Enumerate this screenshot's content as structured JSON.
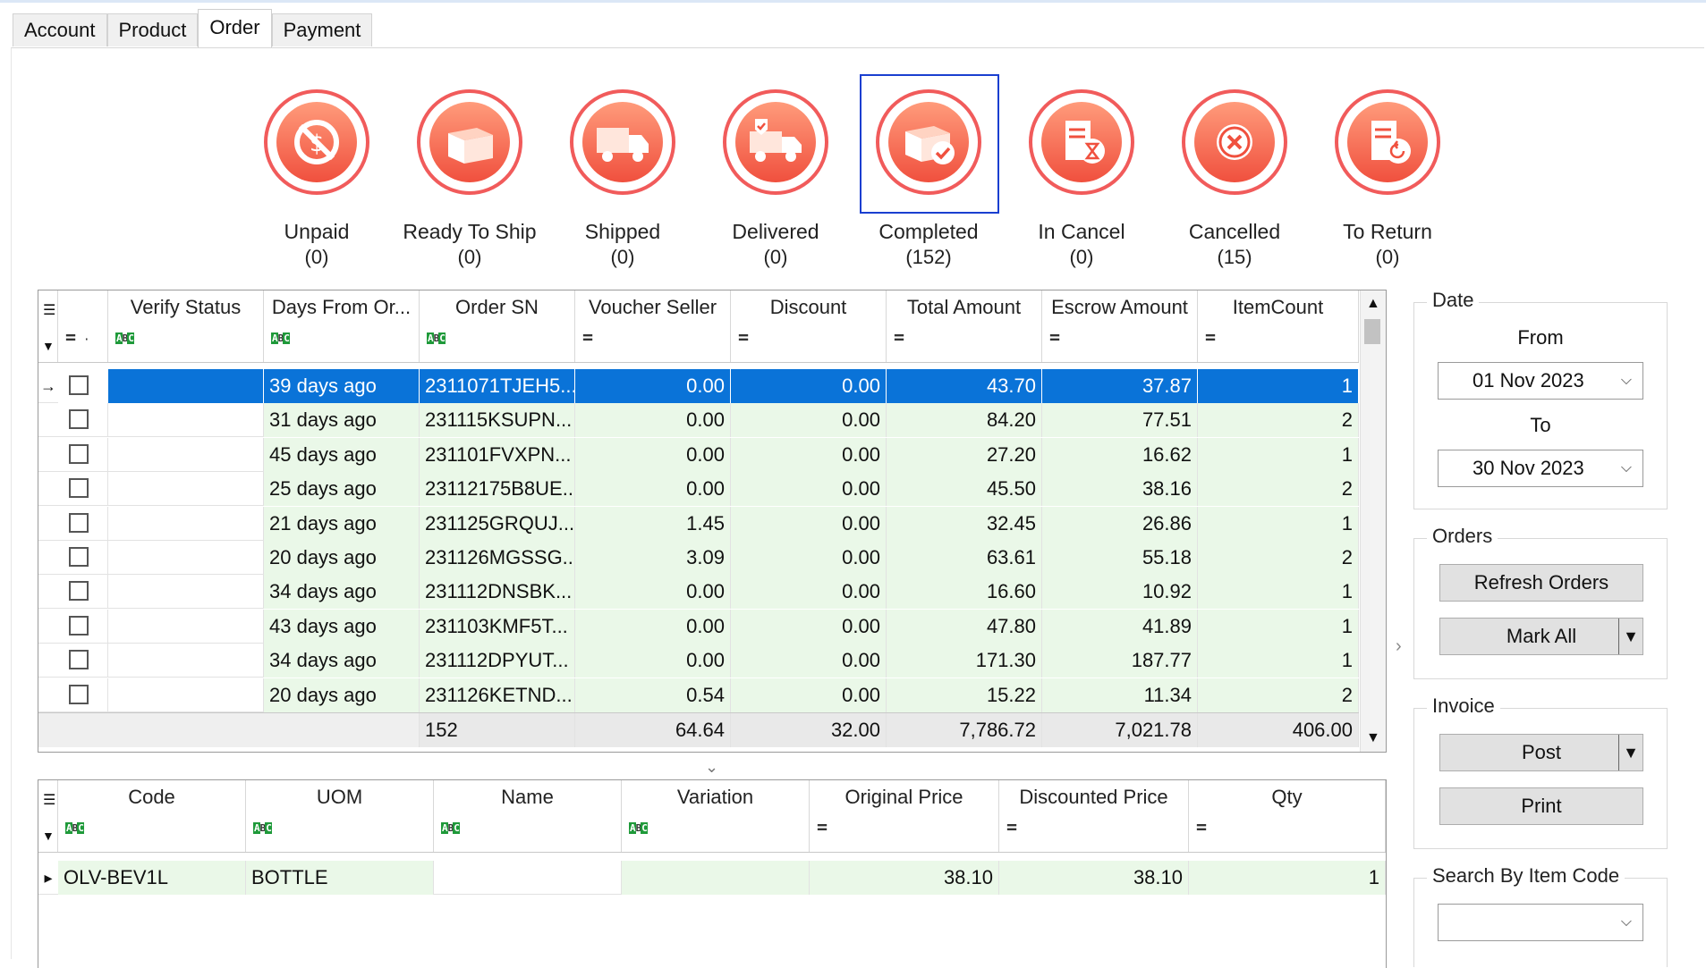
{
  "tabs": [
    "Account",
    "Product",
    "Order",
    "Payment"
  ],
  "active_tab": "Order",
  "statuses": [
    {
      "label": "Unpaid",
      "count": "(0)",
      "icon": "unpaid-icon"
    },
    {
      "label": "Ready To Ship",
      "count": "(0)",
      "icon": "box-icon"
    },
    {
      "label": "Shipped",
      "count": "(0)",
      "icon": "truck-icon"
    },
    {
      "label": "Delivered",
      "count": "(0)",
      "icon": "delivered-truck-icon"
    },
    {
      "label": "Completed",
      "count": "(152)",
      "icon": "completed-box-icon"
    },
    {
      "label": "In Cancel",
      "count": "(0)",
      "icon": "hourglass-document-icon"
    },
    {
      "label": "Cancelled",
      "count": "(15)",
      "icon": "cancel-x-icon"
    },
    {
      "label": "To Return",
      "count": "(0)",
      "icon": "return-document-icon"
    }
  ],
  "orders_grid": {
    "columns": [
      "Verify Status",
      "Days From Or...",
      "Order SN",
      "Voucher Seller",
      "Discount",
      "Total Amount",
      "Escrow Amount",
      "ItemCount"
    ],
    "rows": [
      {
        "verify": "",
        "days": "39 days ago",
        "sn": "2311071TJEH5...",
        "voucher": "0.00",
        "discount": "0.00",
        "total": "43.70",
        "escrow": "37.87",
        "items": "1"
      },
      {
        "verify": "",
        "days": "31 days ago",
        "sn": "231115KSUPN...",
        "voucher": "0.00",
        "discount": "0.00",
        "total": "84.20",
        "escrow": "77.51",
        "items": "2"
      },
      {
        "verify": "",
        "days": "45 days ago",
        "sn": "231101FVXPN...",
        "voucher": "0.00",
        "discount": "0.00",
        "total": "27.20",
        "escrow": "16.62",
        "items": "1"
      },
      {
        "verify": "",
        "days": "25 days ago",
        "sn": "23112175B8UE...",
        "voucher": "0.00",
        "discount": "0.00",
        "total": "45.50",
        "escrow": "38.16",
        "items": "2"
      },
      {
        "verify": "",
        "days": "21 days ago",
        "sn": "231125GRQUJ...",
        "voucher": "1.45",
        "discount": "0.00",
        "total": "32.45",
        "escrow": "26.86",
        "items": "1"
      },
      {
        "verify": "",
        "days": "20 days ago",
        "sn": "231126MGSSG...",
        "voucher": "3.09",
        "discount": "0.00",
        "total": "63.61",
        "escrow": "55.18",
        "items": "2"
      },
      {
        "verify": "",
        "days": "34 days ago",
        "sn": "231112DNSBK...",
        "voucher": "0.00",
        "discount": "0.00",
        "total": "16.60",
        "escrow": "10.92",
        "items": "1"
      },
      {
        "verify": "",
        "days": "43 days ago",
        "sn": "231103KMF5T...",
        "voucher": "0.00",
        "discount": "0.00",
        "total": "47.80",
        "escrow": "41.89",
        "items": "1"
      },
      {
        "verify": "",
        "days": "34 days ago",
        "sn": "231112DPYUT...",
        "voucher": "0.00",
        "discount": "0.00",
        "total": "171.30",
        "escrow": "187.77",
        "items": "1"
      },
      {
        "verify": "",
        "days": "20 days ago",
        "sn": "231126KETND...",
        "voucher": "0.54",
        "discount": "0.00",
        "total": "15.22",
        "escrow": "11.34",
        "items": "2"
      }
    ],
    "footer": {
      "sn": "152",
      "voucher": "64.64",
      "discount": "32.00",
      "total": "7,786.72",
      "escrow": "7,021.78",
      "items": "406.00"
    }
  },
  "items_grid": {
    "columns": [
      "Code",
      "UOM",
      "Name",
      "Variation",
      "Original Price",
      "Discounted Price",
      "Qty"
    ],
    "rows": [
      {
        "code": "OLV-BEV1L",
        "uom": "BOTTLE",
        "name": "",
        "variation": "",
        "orig": "38.10",
        "disc": "38.10",
        "qty": "1"
      }
    ]
  },
  "side": {
    "date_title": "Date",
    "from_label": "From",
    "from_value": "01 Nov 2023",
    "to_label": "To",
    "to_value": "30 Nov 2023",
    "orders_title": "Orders",
    "refresh_label": "Refresh Orders",
    "markall_label": "Mark All",
    "invoice_title": "Invoice",
    "post_label": "Post",
    "print_label": "Print",
    "search_title": "Search By Item Code"
  },
  "colors": {
    "accent": "#0a73d8",
    "icon_red": "#f0503e",
    "row_green": "#eaf8e8"
  }
}
